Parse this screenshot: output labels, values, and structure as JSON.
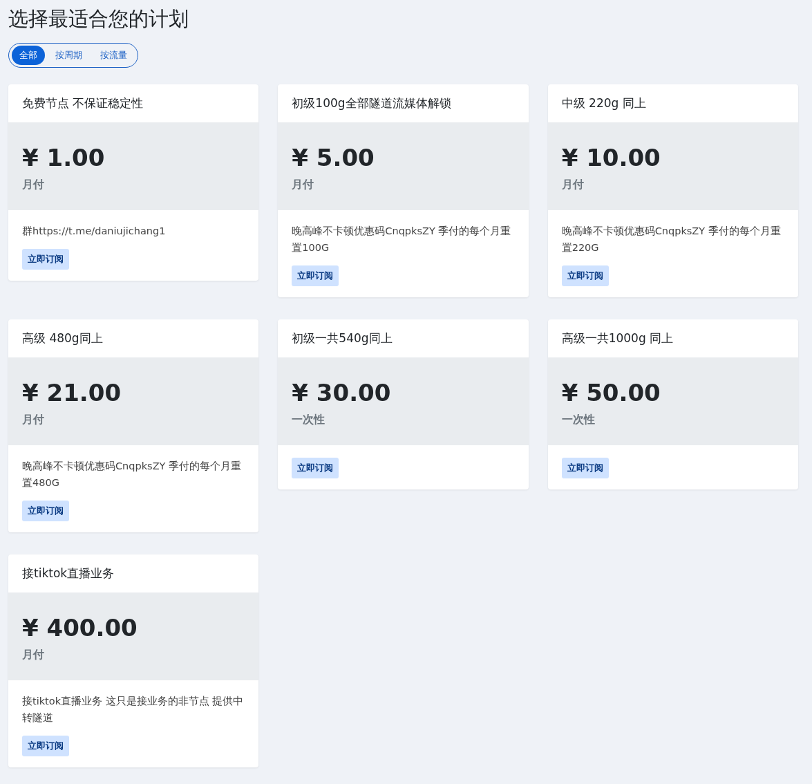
{
  "title": "选择最适合您的计划",
  "tabs": [
    {
      "label": "全部",
      "selected": true
    },
    {
      "label": "按周期",
      "selected": false
    },
    {
      "label": "按流量",
      "selected": false
    }
  ],
  "plans": [
    {
      "name": "免费节点 不保证稳定性",
      "price": "¥ 1.00",
      "period": "月付",
      "description": "群https://t.me/daniujichang1",
      "button": "立即订阅"
    },
    {
      "name": "初级100g全部隧道流媒体解锁",
      "price": "¥ 5.00",
      "period": "月付",
      "description": "晚高峰不卡顿优惠码CnqpksZY 季付的每个月重置100G",
      "button": "立即订阅"
    },
    {
      "name": "中级 220g 同上",
      "price": "¥ 10.00",
      "period": "月付",
      "description": "晚高峰不卡顿优惠码CnqpksZY 季付的每个月重置220G",
      "button": "立即订阅"
    },
    {
      "name": "高级 480g同上",
      "price": "¥ 21.00",
      "period": "月付",
      "description": "晚高峰不卡顿优惠码CnqpksZY 季付的每个月重置480G",
      "button": "立即订阅"
    },
    {
      "name": "初级一共540g同上",
      "price": "¥ 30.00",
      "period": "一次性",
      "button": "立即订阅"
    },
    {
      "name": "高级一共1000g 同上",
      "price": "¥ 50.00",
      "period": "一次性",
      "button": "立即订阅"
    },
    {
      "name": "接tiktok直播业务",
      "price": "¥ 400.00",
      "period": "月付",
      "description": "接tiktok直播业务 这只是接业务的非节点 提供中转隧道",
      "button": "立即订阅"
    }
  ]
}
